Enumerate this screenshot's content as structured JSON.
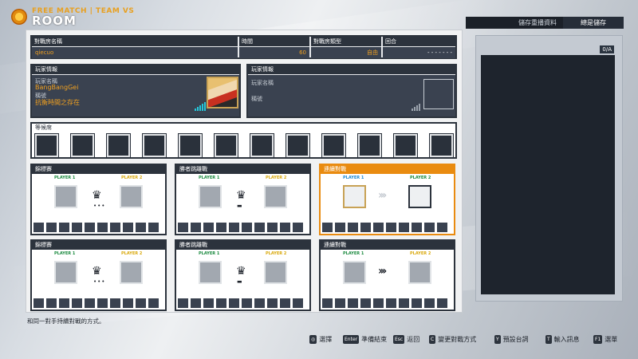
{
  "header": {
    "subtitle": "FREE MATCH | TEAM VS",
    "title": "ROOM"
  },
  "right_panel": {
    "save_label": "儲存重播資料",
    "save_value": "總是儲存",
    "badge": "0/A"
  },
  "room_info": {
    "headers": {
      "room_name": "對戰房名稱",
      "time": "時間",
      "type": "對戰房類型",
      "round": "回合"
    },
    "values": {
      "room_name": "qiecuo",
      "time": "60",
      "type": "自由",
      "round": "- - - - - - -"
    }
  },
  "player_left": {
    "header": "玩家情報",
    "name_label": "玩家名稱",
    "name": "BangBangGei",
    "title_label": "稱號",
    "title": "抗衡時間之存在"
  },
  "player_right": {
    "header": "玩家情報",
    "name_label": "玩家名稱",
    "title_label": "稱號"
  },
  "waiting": {
    "label": "等候席"
  },
  "matches": [
    {
      "title": "錦標賽",
      "p1": "PLAYER 1",
      "p2": "PLAYER 2"
    },
    {
      "title": "勝者跳離戰",
      "p1": "PLAYER 1",
      "p2": "PLAYER 2"
    },
    {
      "title": "連續對戰",
      "p1": "PLAYER 1",
      "p2": "PLAYER 2"
    },
    {
      "title": "錦標賽",
      "p1": "PLAYER 1",
      "p2": "PLAYER 2"
    },
    {
      "title": "勝者跳離戰",
      "p1": "PLAYER 1",
      "p2": "PLAYER 2"
    },
    {
      "title": "連續對戰",
      "p1": "PLAYER 1",
      "p2": "PLAYER 2"
    }
  ],
  "note": "和同一對手持續對戰的方式。",
  "controls": [
    {
      "key": "◎",
      "label": "選擇"
    },
    {
      "key": "Enter",
      "label": "準備結束"
    },
    {
      "key": "Esc",
      "label": "返回"
    },
    {
      "key": "C",
      "label": "變更對戰方式"
    },
    {
      "key": "Y",
      "label": "預設台詞"
    },
    {
      "key": "T",
      "label": "輸入訊息"
    },
    {
      "key": "F1",
      "label": "選單"
    }
  ],
  "colors": {
    "accent": "#e98b10",
    "panel_dark": "#2c333d",
    "signal": "#26c6da"
  }
}
